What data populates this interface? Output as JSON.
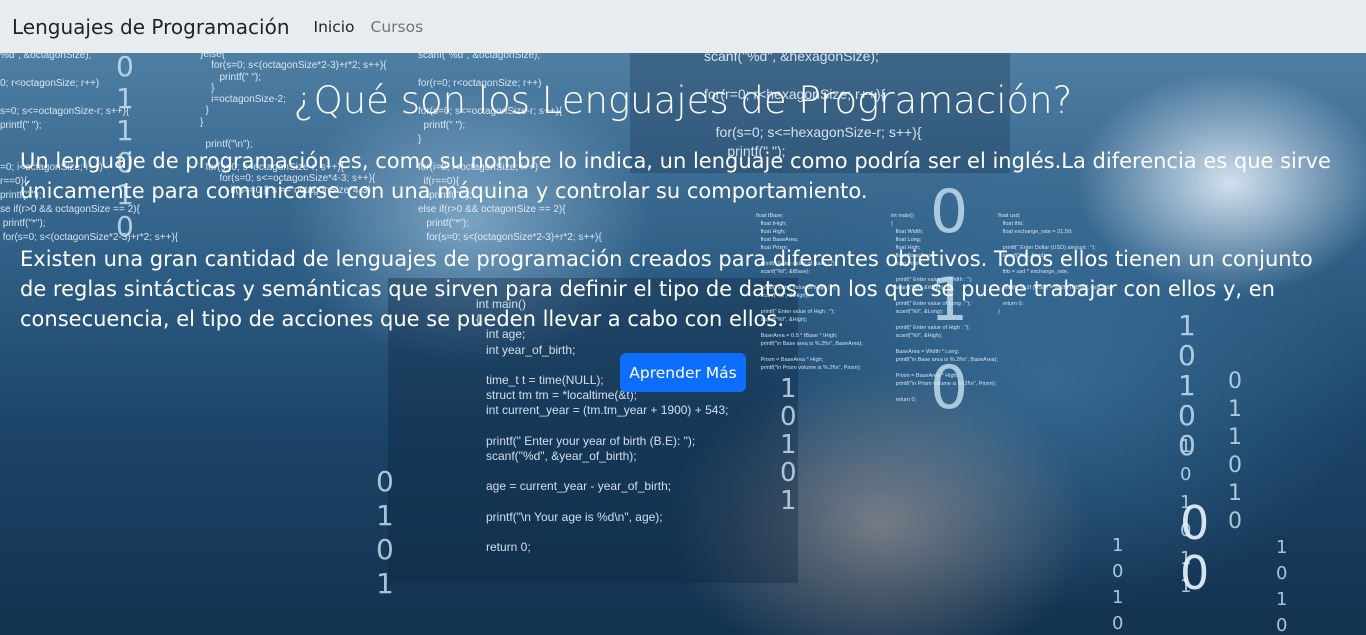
{
  "navbar": {
    "brand": "Lenguajes de Programación",
    "links": [
      {
        "label": "Inicio",
        "active": true
      },
      {
        "label": "Cursos",
        "active": false
      }
    ]
  },
  "hero": {
    "title": "¿Qué son los Lenguajes de Programación?",
    "paragraph_1": "Un lenguaje de programación es, como su nombre lo indica, un lenguaje como podría ser el inglés.La diferencia es que sirve únicamente para comunicarse con una máquina y controlar su comportamiento.",
    "paragraph_2": "Existen una gran cantidad de lenguajes de programación creados para diferentes objetivos. Todos ellos tienen un conjunto de reglas sintácticas y semánticas que sirven para definir el tipo de datos con los que se puede trabajar con ellos y, en consecuencia, el tipo de acciones que se pueden llevar a cabo con ellos.",
    "button_label": "Aprender Más"
  },
  "background_code": {
    "block_left": "%d\", &octagonSize);\n\n0; r<octagonSize; r++)\n\ns=0; s<=octagonSize-r; s++){\nprintf(\" \");\n\n\n=0; i<octagonSize; i++)\nr==0){\nprintf(\" \");\nse if(r>0 && octagonSize == 2){\n printf(\"*\");\n for(s=0; s<(octagonSize*2-3)+r*2; s++){",
    "block_left_mid": "}else{\n    for(s=0; s<(octagonSize*2-3)+r*2; s++){\n       printf(\" \");\n    }\n    i=octagonSize-2;\n  }\n}\n\n  printf(\"\\n\");\n\n  for(s=0; s<octagonSize-r; s++){\n       for(s=0; s<=octagonSize*4-3; s++){\n           if(s==0 || s == octagonSize*4-3)",
    "block_center": "scanf(\"%d\", &octagonSize);\n\nfor(r=0; r<octagonSize; r++)\n\nfor(s=0; s<=octagonSize-r; s++){\n  printf(\" \");\n}\n\nfor(i=0; i<octagonSize; i++)\n  if(r==0){\n    printf(\"*\");\nelse if(r>0 && octagonSize == 2){\n   printf(\"*\");\n   for(s=0; s<(octagonSize*2-3)+r*2; s++){",
    "block_hexagon": "scanf(\"%d\", &hexagonSize);\n\nfor(r=0; r<hexagonSize; r++){\n\n   for(s=0; s<=hexagonSize-r; s++){\n      printf(\" \");",
    "block_age": "int main()\n{\n   int age;\n   int year_of_birth;\n\n   time_t t = time(NULL);\n   struct tm tm = *localtime(&t);\n   int current_year = (tm.tm_year + 1900) + 543;\n\n   printf(\" Enter your year of birth (B.E): \");\n   scanf(\"%d\", &year_of_birth);\n\n   age = current_year - year_of_birth;\n\n   printf(\"\\n Your age is %d\\n\", age);\n\n   return 0;",
    "block_prism": "float tBase;\n   float tHigh;\n   float High;\n   float BaseArea;\n   float Prism;\n\n   printf(\" Enter value of Base : \");\n   scanf(\"%f\", &tBase);\n\n   printf(\" Enter value of tHigh : \");\n   scanf(\"%f\", &tHigh);\n\n   printf(\" Enter value of High : \");\n   scanf(\"%f\", &High);\n\n   BaseArea = 0.5 * tBase * tHigh;\n   printf(\"\\n Base area is %.2f\\n\", BaseArea);\n\n   Prism = BaseArea * High;\n   printf(\"\\n Prism volume is %.2f\\n\", Prism);",
    "block_width": "int main()\n{\n   float Width;\n   float Long;\n   float High;\n   float BaseArea;\n   float Prism;\n\n   printf(\" Enter value of Width : \");\n   scanf(\"%f\", &Width);\n\n   printf(\" Enter value of Long : \");\n   scanf(\"%f\", &Long);\n\n   printf(\" Enter value of High : \");\n   scanf(\"%f\", &High);\n\n   BaseArea = Width * Long;\n   printf(\"\\n Base area is %.2f\\n\", BaseArea);\n\n   Prism = BaseArea * High;\n   printf(\"\\n Prism volume is %.2f\\n\", Prism);\n\n   return 0;",
    "block_dollar": "float usd;\n   float thb;\n   float exchange_rate = 31.50;\n\n   printf(\" Enter Dollar (USD) amount : \");\n   scanf(\"%f\", &usd);\n\n   thb = usd * exchange_rate;\n\n   printf(\" %.2f (USD) = %.2f (THB)\\n\", usd, thb);\n\n   return 0;\n}",
    "digit_column_1": "0\n1\n1\n0\n1\n0",
    "digit_column_2": "0\n1\n0\n1",
    "digit_column_3": "1\n0\n1\n0\n1",
    "digit_column_4": "1\n0\n1\n0\n0",
    "digit_column_5": "0\n1\n1\n0\n1\n0",
    "digit_column_6": "1\n0\n1\n0",
    "digit_column_7": "1\n0\n1\n0\n1\n1",
    "digit_column_8": "1\n0\n1\n0",
    "digit_big": "0\n1\n0",
    "digit_large": "0\n1\n0",
    "digit_big_mid": "0\n0"
  }
}
